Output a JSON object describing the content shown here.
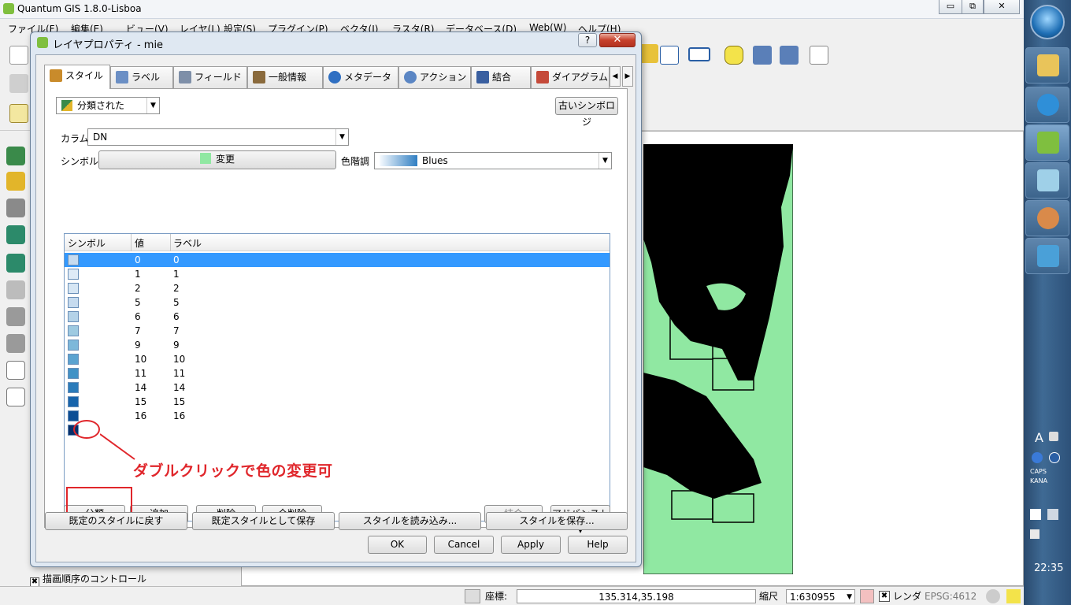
{
  "app": {
    "title": "Quantum GIS 1.8.0-Lisboa",
    "menu": [
      "ファイル(F)",
      "編集(E)",
      "ビュー(V)",
      "レイヤ(L)",
      "設定(S)",
      "プラグイン(P)",
      "ベクタ(J)",
      "ラスタ(R)",
      "データベース(D)",
      "Web(W)",
      "ヘルプ(H)"
    ],
    "minimize": "▭",
    "restore": "⧉",
    "close": "✕"
  },
  "dialog": {
    "title": "レイヤプロパティ - mie",
    "help": "?",
    "close": "✕",
    "tabs": [
      {
        "label": "スタイル",
        "color": "#c98b2b"
      },
      {
        "label": "ラベル",
        "color": "#6b8fc5"
      },
      {
        "label": "フィールド",
        "color": "#7e8fa8"
      },
      {
        "label": "一般情報",
        "color": "#8a6a3c"
      },
      {
        "label": "メタデータ",
        "color": "#2f6fc2"
      },
      {
        "label": "アクション",
        "color": "#5b86c4"
      },
      {
        "label": "結合",
        "color": "#3a5fa0"
      },
      {
        "label": "ダイアグラム",
        "color": "#c54a3a"
      }
    ],
    "tab_prev": "◀",
    "tab_next": "▶",
    "renderer": {
      "value": "分類された",
      "arrow": "▼"
    },
    "old_symbology": "古いシンボロジ",
    "column_label": "カラム",
    "column": {
      "value": "DN",
      "arrow": "▼"
    },
    "symbol_label": "シンボル",
    "symbol_button": "変更",
    "color_ramp_label": "色階調",
    "color_ramp": {
      "value": "Blues",
      "arrow": "▼"
    },
    "table": {
      "headers": [
        "シンボル",
        "値",
        "ラベル"
      ],
      "rows": [
        {
          "value": "0",
          "label": "0",
          "color": "#c6dbef"
        },
        {
          "value": "1",
          "label": "1",
          "color": "#deebf7"
        },
        {
          "value": "2",
          "label": "2",
          "color": "#d6e6f4"
        },
        {
          "value": "5",
          "label": "5",
          "color": "#c6dbef"
        },
        {
          "value": "6",
          "label": "6",
          "color": "#b4d2e8"
        },
        {
          "value": "7",
          "label": "7",
          "color": "#9ecae1"
        },
        {
          "value": "9",
          "label": "9",
          "color": "#7db8da"
        },
        {
          "value": "10",
          "label": "10",
          "color": "#5ba3d0"
        },
        {
          "value": "11",
          "label": "11",
          "color": "#4292c6"
        },
        {
          "value": "14",
          "label": "14",
          "color": "#2b7bba"
        },
        {
          "value": "15",
          "label": "15",
          "color": "#1764ab"
        },
        {
          "value": "16",
          "label": "16",
          "color": "#0b4d94"
        },
        {
          "value": "",
          "label": "",
          "color": "#08306b"
        }
      ]
    },
    "buttons": {
      "classify": "分類",
      "add": "追加",
      "delete": "削除",
      "delete_all": "全削除",
      "join": "結合",
      "advanced": "アドバンスト ▾",
      "restore_default": "既定のスタイルに戻す",
      "save_default": "既定スタイルとして保存",
      "load_style": "スタイルを読み込み...",
      "save_style": "スタイルを保存...",
      "ok": "OK",
      "cancel": "Cancel",
      "apply": "Apply",
      "help": "Help"
    },
    "annotation": "ダブルクリックで色の変更可"
  },
  "layers_panel": {
    "draw_order": "描画順序のコントロール",
    "checked": "✖"
  },
  "statusbar": {
    "coord_label": "座標:",
    "coord": "135.314,35.198",
    "scale_label": "縮尺",
    "scale": "1:630955",
    "scale_arrow": "▼",
    "render_label": "レンダ",
    "epsg": "EPSG:4612"
  },
  "taskbar": {
    "clock": "22:35",
    "caps": "CAPS",
    "kana": "KANA",
    "ime": "A"
  },
  "colors": {
    "map_fill": "#90e8a2",
    "selection": "#3399ff",
    "annotation": "#e0262b"
  }
}
